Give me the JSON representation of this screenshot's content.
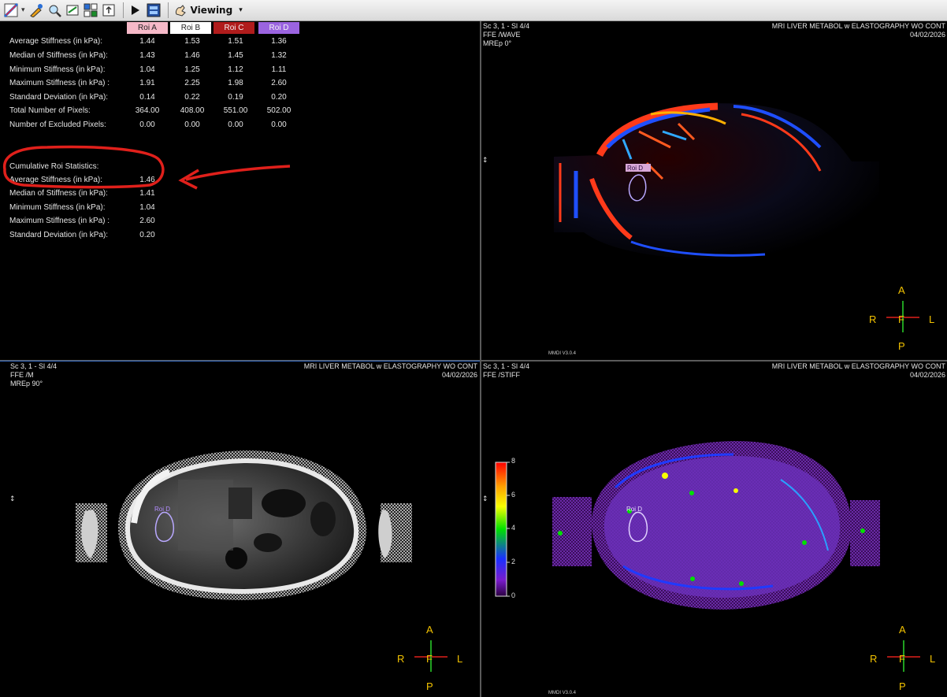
{
  "toolbar": {
    "viewing_label": "Viewing",
    "dropdown_glyph": "▾",
    "icons": [
      "window-level-icon",
      "annotate-icon",
      "zoom-icon",
      "measure-icon",
      "layout-icon",
      "export-icon",
      "play-icon",
      "film-icon",
      "hand-icon"
    ]
  },
  "stats": {
    "roi_headers": [
      {
        "label": "Roi A",
        "color": "#f6b9c8"
      },
      {
        "label": "Roi B",
        "color": "#ffffff"
      },
      {
        "label": "Roi C",
        "color": "#b01c1c"
      },
      {
        "label": "Roi D",
        "color": "#9b64e0"
      }
    ],
    "rows": [
      {
        "label": "Average Stiffness (in kPa):",
        "values": [
          "1.44",
          "1.53",
          "1.51",
          "1.36"
        ]
      },
      {
        "label": "Median of Stiffness (in kPa):",
        "values": [
          "1.43",
          "1.46",
          "1.45",
          "1.32"
        ]
      },
      {
        "label": "Minimum Stiffness (in kPa):",
        "values": [
          "1.04",
          "1.25",
          "1.12",
          "1.11"
        ]
      },
      {
        "label": "Maximum Stiffness (in kPa) :",
        "values": [
          "1.91",
          "2.25",
          "1.98",
          "2.60"
        ]
      },
      {
        "label": "Standard Deviation (in kPa):",
        "values": [
          "0.14",
          "0.22",
          "0.19",
          "0.20"
        ]
      },
      {
        "label": "Total Number of Pixels:",
        "values": [
          "364.00",
          "408.00",
          "551.00",
          "502.00"
        ]
      },
      {
        "label": "Number of Excluded Pixels:",
        "values": [
          "0.00",
          "0.00",
          "0.00",
          "0.00"
        ]
      }
    ],
    "cumulative_title": "Cumulative Roi Statistics:",
    "cumulative_rows": [
      {
        "label": "Average Stiffness (in kPa):",
        "value": "1.46"
      },
      {
        "label": "Median of Stiffness (in kPa):",
        "value": "1.41"
      },
      {
        "label": "Minimum Stiffness (in kPa):",
        "value": "1.04"
      },
      {
        "label": "Maximum Stiffness (in kPa) :",
        "value": "2.60"
      },
      {
        "label": "Standard Deviation (in kPa):",
        "value": "0.20"
      }
    ]
  },
  "viewports": {
    "tr": {
      "series": "Sc 3, 1 - Sl 4/4",
      "seq": "FFE  /WAVE",
      "phase": "MREp 0°",
      "study": "MRI LIVER METABOL w ELASTOGRAPHY WO CONT",
      "date": "04/02/2026",
      "roi_label": "Roi D",
      "version": "MMDI V3.0.4"
    },
    "bl": {
      "series": "Sc 3, 1 - Sl 4/4",
      "seq": "FFE  /M",
      "phase": "MREp 90°",
      "study": "MRI LIVER METABOL w ELASTOGRAPHY WO CONT",
      "date": "04/02/2026",
      "roi_label": "Roi D"
    },
    "br": {
      "series": "Sc 3, 1 - Sl 4/4",
      "seq": "FFE  /STIFF",
      "study": "MRI LIVER METABOL w ELASTOGRAPHY WO CONT",
      "date": "04/02/2026",
      "roi_label": "Roi D",
      "version": "MMDI V3.0.4"
    }
  },
  "orientation": {
    "a": "A",
    "p": "P",
    "r": "R",
    "l": "L",
    "f": "F"
  },
  "scroll_marker": "↕",
  "colorbar": {
    "labels": [
      "8",
      "6",
      "4",
      "2",
      "0"
    ]
  },
  "colors": {
    "annotation_red": "#e0201b",
    "orientation_yellow": "#f2c200",
    "split_blue": "#3a6fc8"
  }
}
